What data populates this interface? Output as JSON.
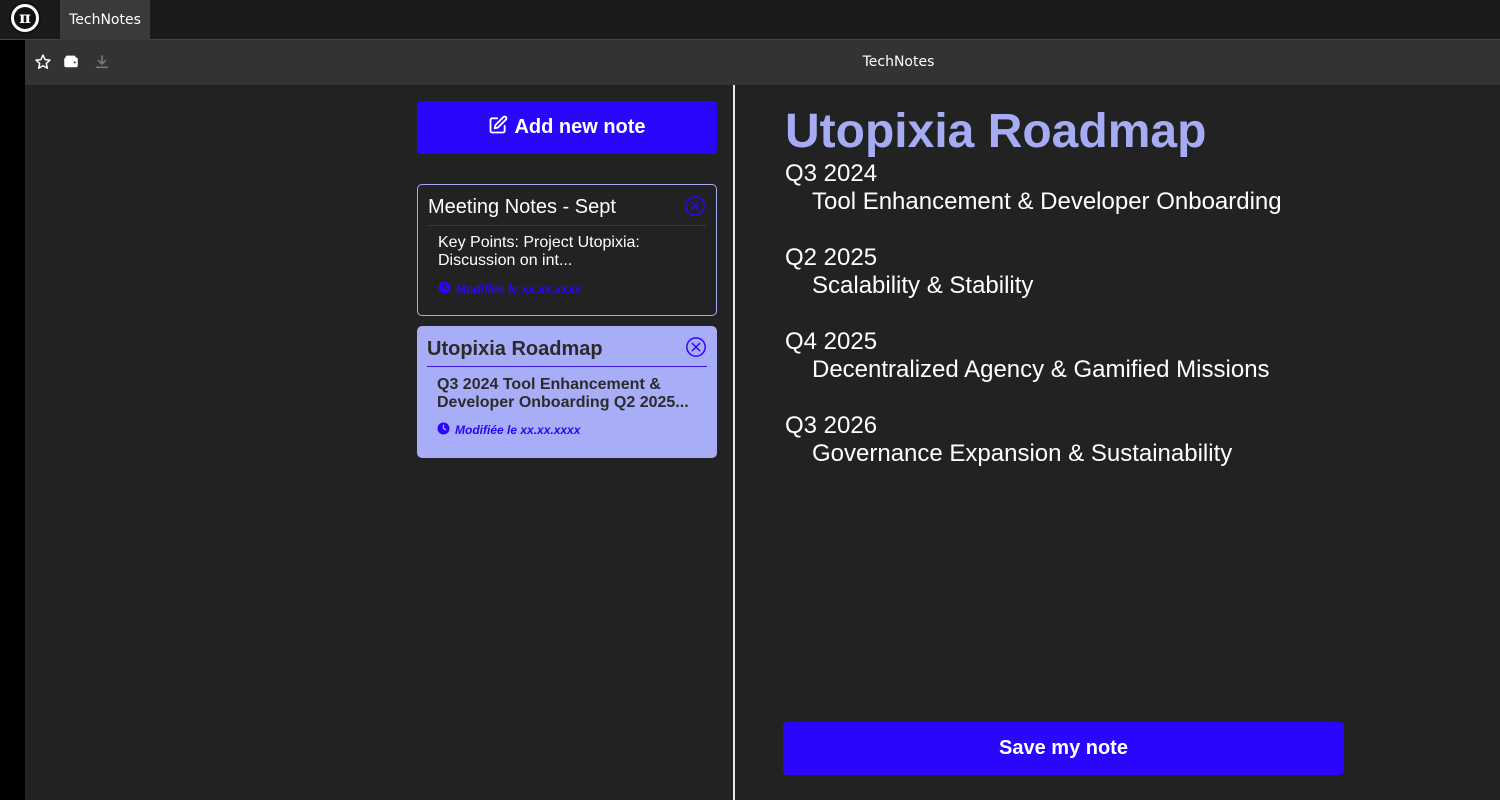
{
  "browser": {
    "logo_glyph": "π",
    "tab_label": "TechNotes",
    "toolbar_title": "TechNotes"
  },
  "colors": {
    "accent": "#2a06fa",
    "accent_light": "#a7adf6",
    "background": "#222222"
  },
  "sidebar": {
    "add_button_label": "Add new note",
    "notes": [
      {
        "title": "Meeting Notes - Sept",
        "snippet": "Key Points: Project Utopixia: Discussion on int...",
        "modified": "Modifiée le xx.xx.xxxx",
        "selected": false
      },
      {
        "title": "Utopixia Roadmap",
        "snippet": "Q3 2024 Tool Enhancement & Developer Onboarding Q2 2025...",
        "modified": "Modifiée le xx.xx.xxxx",
        "selected": true
      }
    ]
  },
  "editor": {
    "title": "Utopixia Roadmap",
    "items": [
      {
        "quarter": "Q3 2024",
        "desc": "Tool Enhancement & Developer Onboarding"
      },
      {
        "quarter": "Q2 2025",
        "desc": "Scalability & Stability"
      },
      {
        "quarter": "Q4 2025",
        "desc": "Decentralized Agency & Gamified Missions"
      },
      {
        "quarter": "Q3 2026",
        "desc": "Governance Expansion & Sustainability"
      }
    ],
    "save_label": "Save my note"
  }
}
